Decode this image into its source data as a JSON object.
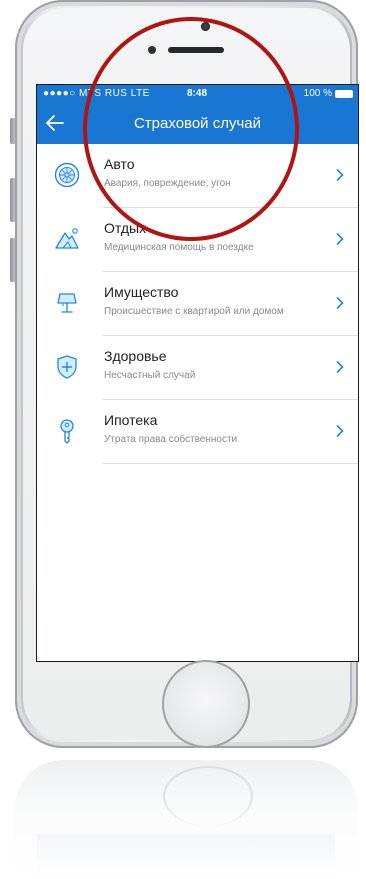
{
  "status_bar": {
    "carrier": "●●●●○ MTS RUS  LTE",
    "time": "8:48",
    "battery": "100 %"
  },
  "nav": {
    "title": "Страховой случай",
    "back_icon": "arrow-left-icon"
  },
  "items": [
    {
      "title": "Авто",
      "subtitle": "Авария, повреждение, угон",
      "icon": "car-wheel-icon"
    },
    {
      "title": "Отдых",
      "subtitle": "Медицинская помощь в поездке",
      "icon": "mountain-icon"
    },
    {
      "title": "Имущество",
      "subtitle": "Происшествие с квартирой или домом",
      "icon": "lamp-icon"
    },
    {
      "title": "Здоровье",
      "subtitle": "Несчастный случай",
      "icon": "shield-plus-icon"
    },
    {
      "title": "Ипотека",
      "subtitle": "Утрата права собственности",
      "icon": "key-icon"
    }
  ],
  "colors": {
    "accent": "#1976d2",
    "icon": "#1e88e5",
    "annotation": "#b21414"
  }
}
